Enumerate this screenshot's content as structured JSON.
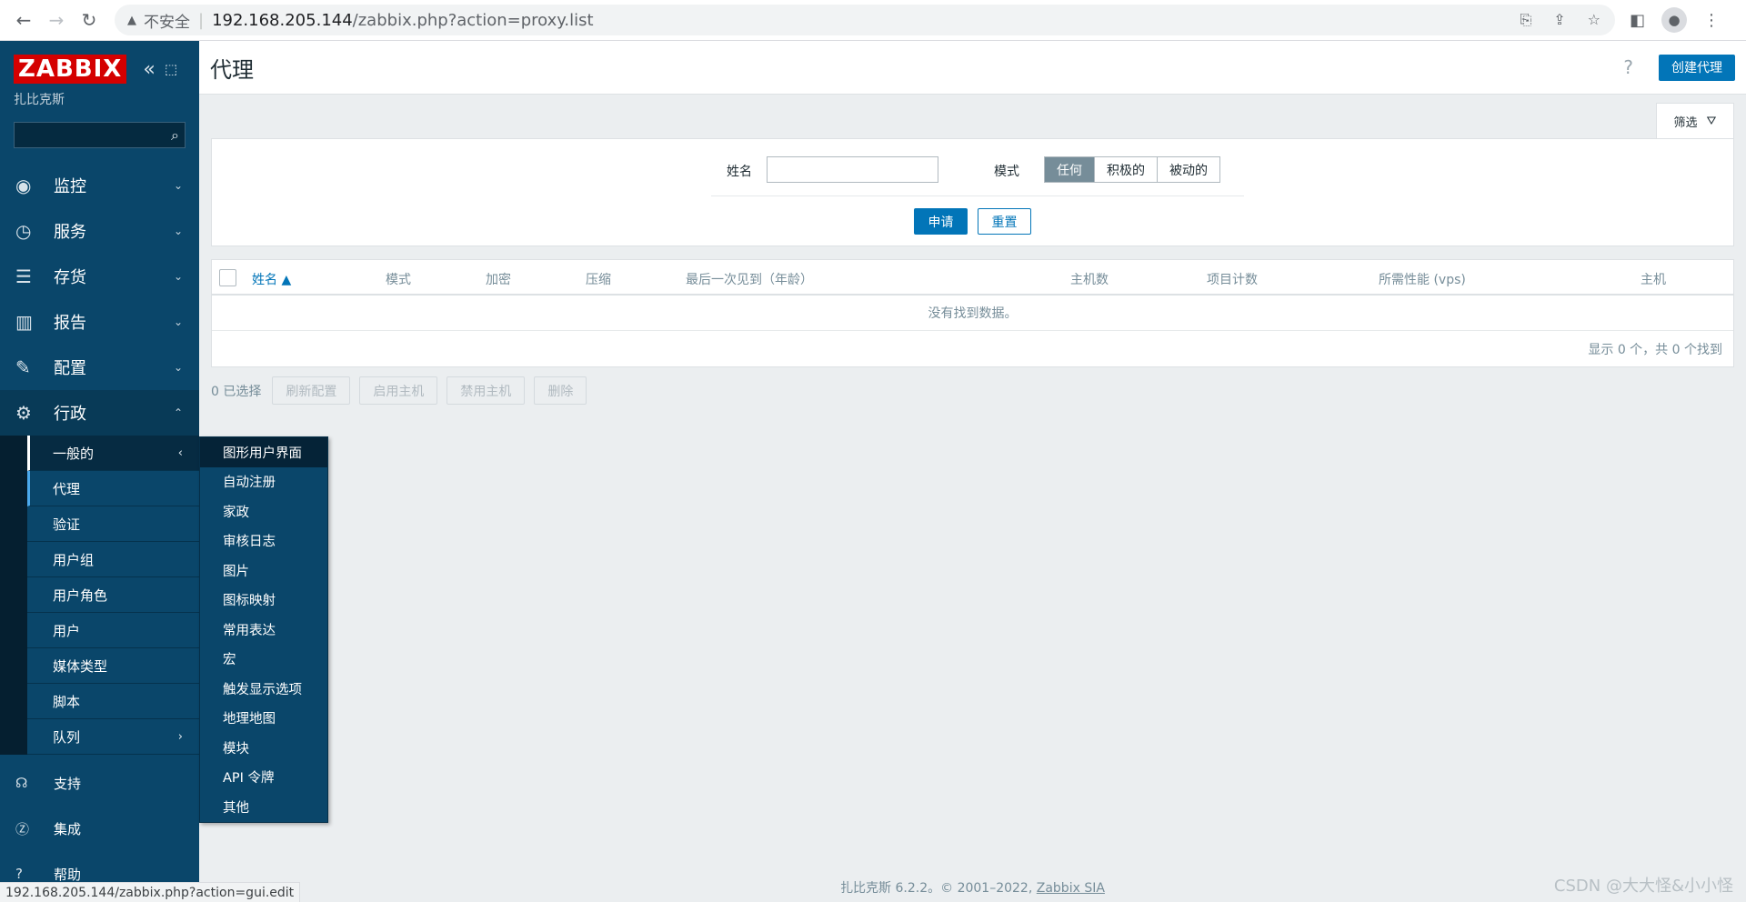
{
  "browser": {
    "insecure_label": "不安全",
    "url_host": "192.168.205.144",
    "url_path": "/zabbix.php?action=proxy.list",
    "status_url": "192.168.205.144/zabbix.php?action=gui.edit"
  },
  "sidebar": {
    "logo": "ZABBIX",
    "server_name": "扎比克斯",
    "menu": [
      {
        "label": "监控",
        "icon": "eye-icon"
      },
      {
        "label": "服务",
        "icon": "stopwatch-icon"
      },
      {
        "label": "存货",
        "icon": "list-icon"
      },
      {
        "label": "报告",
        "icon": "bar-chart-icon"
      },
      {
        "label": "配置",
        "icon": "wrench-icon"
      },
      {
        "label": "行政",
        "icon": "gear-icon"
      }
    ],
    "admin_submenu": [
      "一般的",
      "代理",
      "验证",
      "用户组",
      "用户角色",
      "用户",
      "媒体类型",
      "脚本",
      "队列"
    ],
    "bottom": [
      {
        "label": "支持",
        "icon": "headset-icon"
      },
      {
        "label": "集成",
        "icon": "z-icon"
      },
      {
        "label": "帮助",
        "icon": "question-icon"
      }
    ]
  },
  "flyout": [
    "图形用户界面",
    "自动注册",
    "家政",
    "审核日志",
    "图片",
    "图标映射",
    "常用表达",
    "宏",
    "触发显示选项",
    "地理地图",
    "模块",
    "API 令牌",
    "其他"
  ],
  "header": {
    "title": "代理",
    "help": "?",
    "create_button": "创建代理"
  },
  "filter": {
    "tab_label": "筛选",
    "name_label": "姓名",
    "name_value": "",
    "mode_label": "模式",
    "mode_options": [
      "任何",
      "积极的",
      "被动的"
    ],
    "mode_selected": "任何",
    "apply": "申请",
    "reset": "重置"
  },
  "table": {
    "columns": [
      "姓名 ▲",
      "模式",
      "加密",
      "压缩",
      "最后一次见到（年龄）",
      "主机数",
      "项目计数",
      "所需性能 (vps)",
      "主机"
    ],
    "empty_message": "没有找到数据。",
    "pager": "显示 0 个，共 0 个找到"
  },
  "actions": {
    "selected": "0 已选择",
    "buttons": [
      "刷新配置",
      "启用主机",
      "禁用主机",
      "删除"
    ]
  },
  "footer": {
    "text": "扎比克斯 6.2.2。© 2001–2022, ",
    "link": "Zabbix SIA",
    "watermark": "CSDN @大大怪&小小怪"
  }
}
